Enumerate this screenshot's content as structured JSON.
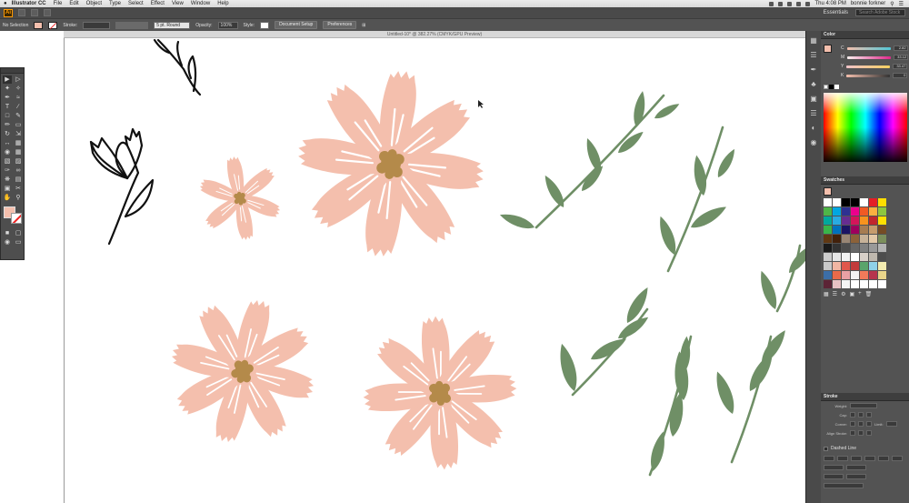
{
  "menubar": {
    "app_name": "Illustrator CC",
    "items": [
      "File",
      "Edit",
      "Object",
      "Type",
      "Select",
      "Effect",
      "View",
      "Window",
      "Help"
    ],
    "clock": "Thu 4:08 PM",
    "user": "bonnie forkner"
  },
  "appbar": {
    "logo": "Ai",
    "workspace": "Essentials",
    "search_placeholder": "Search Adobe Stock"
  },
  "control": {
    "selection": "No Selection",
    "stroke_label": "Stroke:",
    "brush": "5 pt. Round",
    "opacity_label": "Opacity:",
    "opacity_value": "100%",
    "style_label": "Style:",
    "document_setup": "Document Setup",
    "preferences": "Preferences"
  },
  "document": {
    "title": "Untitled-10* @ 382.27% (CMYK/GPU Preview)"
  },
  "colors": {
    "petal": "#f4bfad",
    "center": "#b48a4a",
    "leaf": "#6f8f66",
    "ink": "#111111"
  },
  "panels": {
    "color": {
      "title": "Color",
      "channels": [
        {
          "label": "C",
          "value": "2.82"
        },
        {
          "label": "M",
          "value": "33.12"
        },
        {
          "label": "Y",
          "value": "33.47"
        },
        {
          "label": "K",
          "value": "0"
        }
      ]
    },
    "swatches": {
      "title": "Swatches"
    },
    "stroke": {
      "title": "Stroke",
      "weight_label": "Weight:",
      "cap_label": "Cap:",
      "corner_label": "Corner:",
      "limit_label": "Limit:",
      "align_label": "Align Stroke:",
      "dashed_label": "Dashed Line"
    }
  }
}
